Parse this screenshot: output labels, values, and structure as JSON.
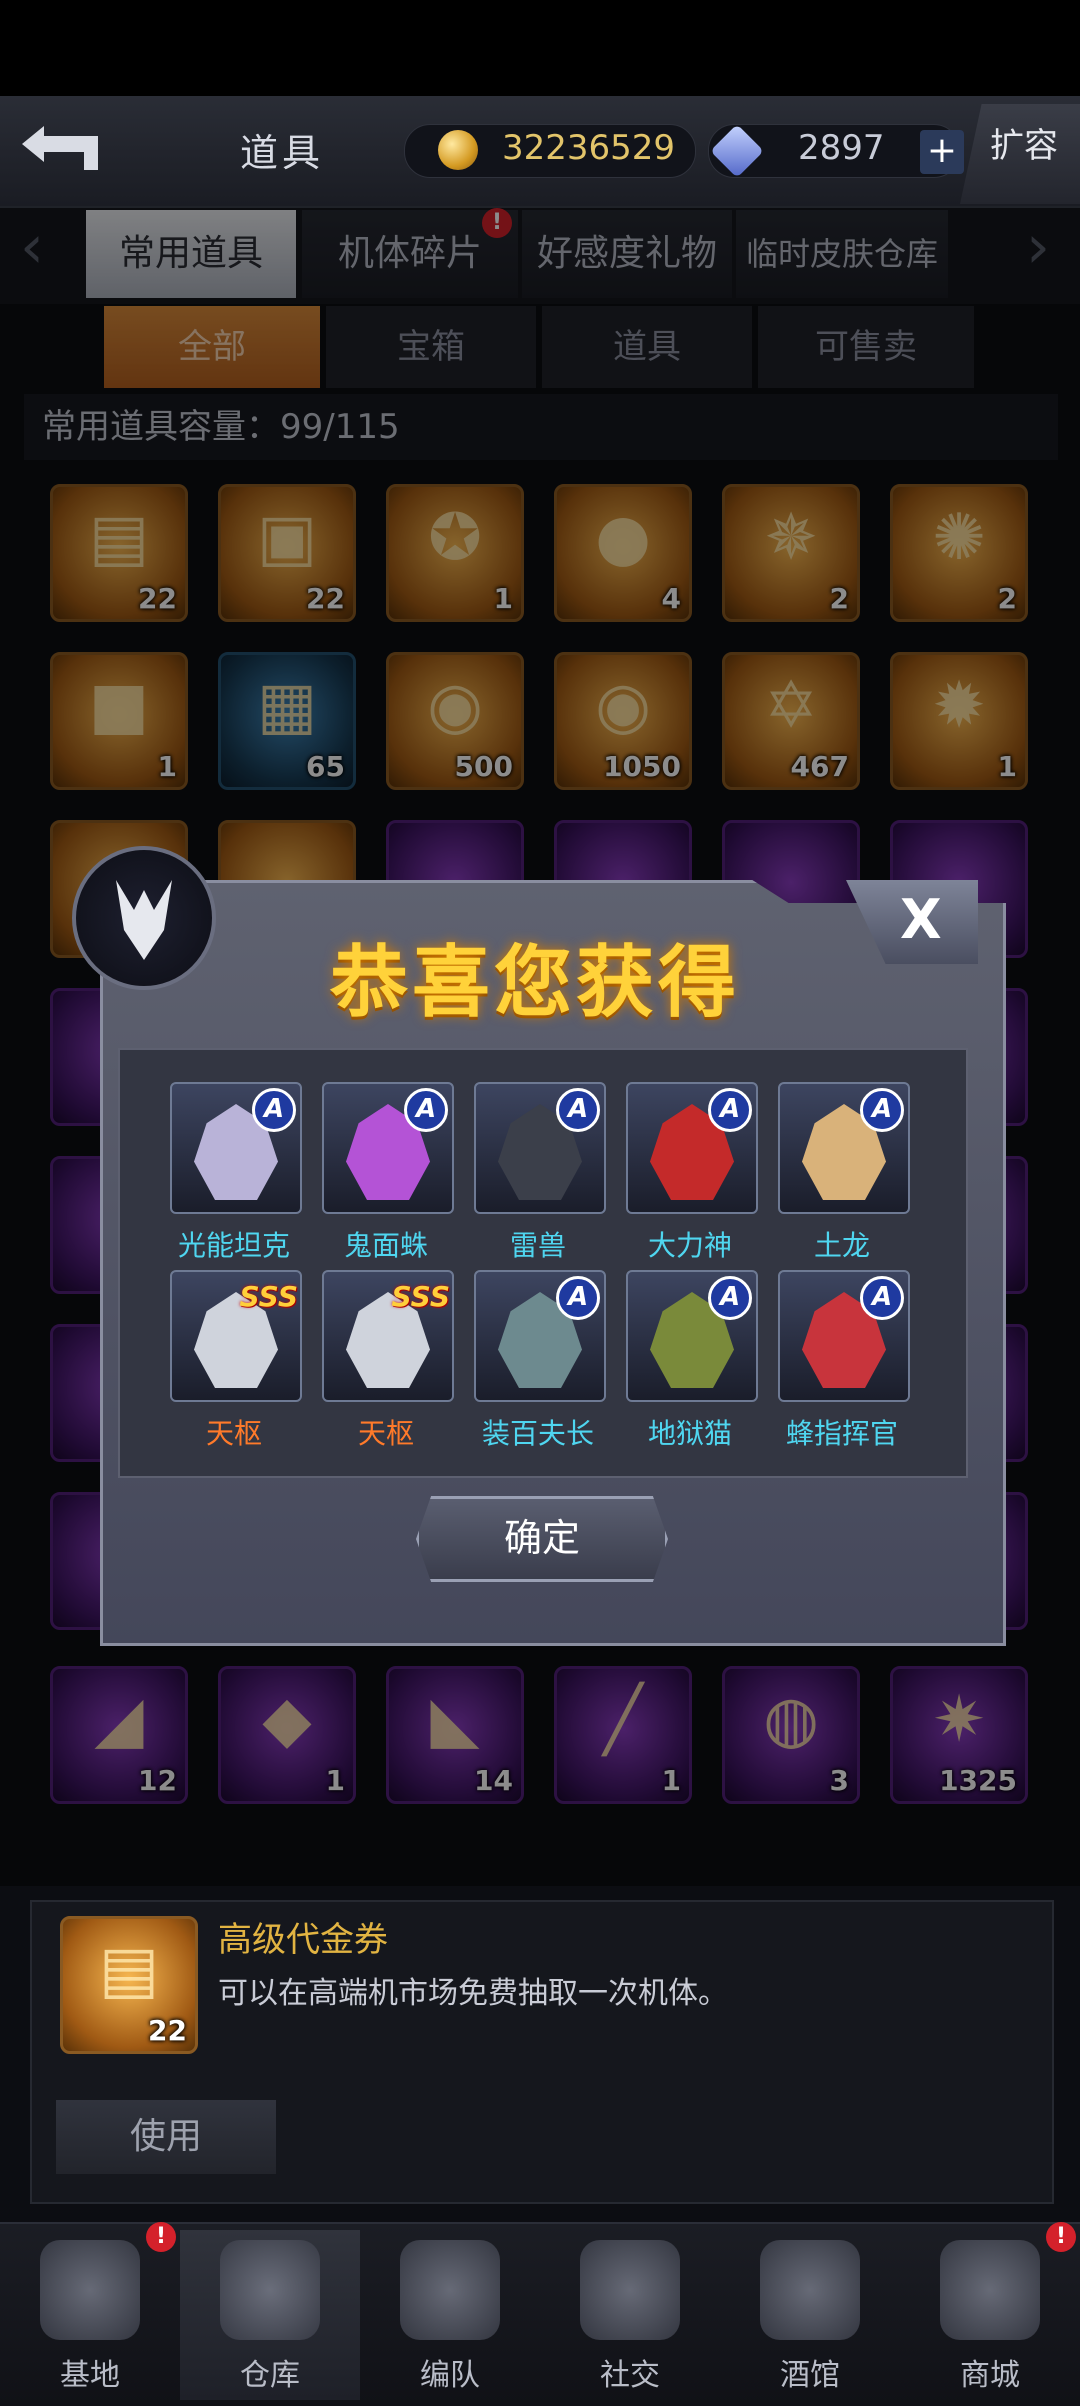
{
  "header": {
    "title": "道具",
    "coins": "32236529",
    "gems": "2897",
    "plus": "+",
    "expand_label": "扩容"
  },
  "tabs": [
    {
      "label": "常用道具",
      "active": true
    },
    {
      "label": "机体碎片",
      "badge": "!"
    },
    {
      "label": "好感度礼物"
    },
    {
      "label": "临时皮肤仓库"
    }
  ],
  "filters": [
    "全部",
    "宝箱",
    "道具",
    "可售卖"
  ],
  "capacity_label": "常用道具容量：99/115",
  "items_row1": [
    {
      "icon": "voucher-cards",
      "count": "22"
    },
    {
      "icon": "supply-box",
      "count": "22"
    },
    {
      "icon": "rank-medal",
      "count": "1"
    },
    {
      "icon": "red-orb",
      "count": "4"
    },
    {
      "icon": "silver-emblem",
      "count": "2"
    },
    {
      "icon": "gold-gear",
      "count": "2"
    }
  ],
  "items_row2": [
    {
      "icon": "red-crate",
      "count": "1"
    },
    {
      "icon": "circuit-chip",
      "count": "65"
    },
    {
      "icon": "n-coin",
      "count": "500"
    },
    {
      "icon": "wing-coin",
      "count": "1050"
    },
    {
      "icon": "star-badge",
      "count": "467"
    },
    {
      "icon": "gold-medal",
      "count": "1"
    }
  ],
  "items_row7": [
    {
      "icon": "armor-piece",
      "count": "12"
    },
    {
      "icon": "red-crystal",
      "count": "1"
    },
    {
      "icon": "dark-wing",
      "count": "14"
    },
    {
      "icon": "sword-part",
      "count": "1"
    },
    {
      "icon": "engine-part",
      "count": "3"
    },
    {
      "icon": "shard-pile",
      "count": "1325"
    }
  ],
  "modal": {
    "title": "恭喜您获得",
    "close_label": "X",
    "confirm_label": "确定",
    "rewards": [
      {
        "name": "光能坦克",
        "rank": "A",
        "name_color": "#4fd6f0",
        "tint": "#b9b3d8"
      },
      {
        "name": "鬼面蛛",
        "rank": "A",
        "name_color": "#4fd6f0",
        "tint": "#b453d6"
      },
      {
        "name": "雷兽",
        "rank": "A",
        "name_color": "#4fd6f0",
        "tint": "#3b3f4a"
      },
      {
        "name": "大力神",
        "rank": "A",
        "name_color": "#4fd6f0",
        "tint": "#c42a2a"
      },
      {
        "name": "土龙",
        "rank": "A",
        "name_color": "#4fd6f0",
        "tint": "#d9b27a"
      },
      {
        "name": "天枢",
        "rank": "SSS",
        "name_color": "#ff7a2a",
        "tint": "#cfd3dc"
      },
      {
        "name": "天枢",
        "rank": "SSS",
        "name_color": "#ff7a2a",
        "tint": "#cfd3dc"
      },
      {
        "name": "装百夫长",
        "rank": "A",
        "name_color": "#4fd6f0",
        "tint": "#6d8a8f"
      },
      {
        "name": "地狱猫",
        "rank": "A",
        "name_color": "#4fd6f0",
        "tint": "#7a8a3a"
      },
      {
        "name": "蜂指挥官",
        "rank": "A",
        "name_color": "#4fd6f0",
        "tint": "#c8343c"
      }
    ]
  },
  "detail": {
    "name": "高级代金券",
    "description": "可以在高端机市场免费抽取一次机体。",
    "count": "22",
    "use_label": "使用"
  },
  "bottom_nav": [
    {
      "label": "基地",
      "badge": "!"
    },
    {
      "label": "仓库",
      "active": true
    },
    {
      "label": "编队"
    },
    {
      "label": "社交"
    },
    {
      "label": "酒馆"
    },
    {
      "label": "商城",
      "badge": "!"
    }
  ]
}
